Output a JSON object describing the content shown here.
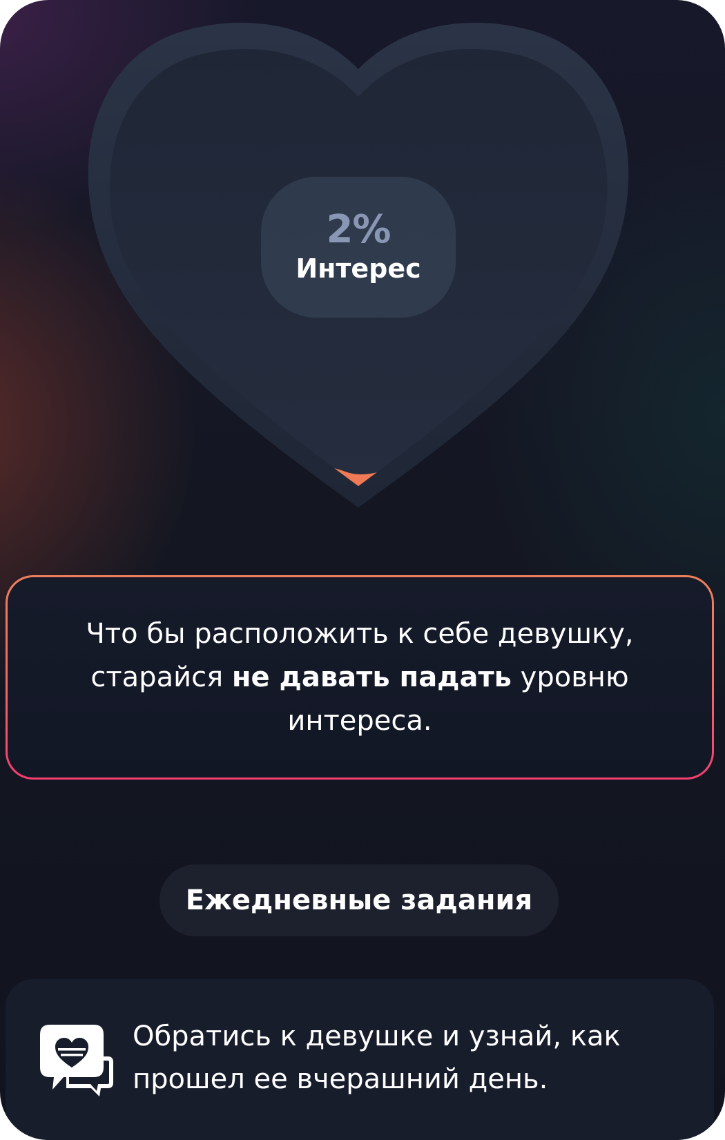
{
  "interest": {
    "value": "2%",
    "label": "Интерес",
    "level": 0.02
  },
  "tip": {
    "line1": "Что бы расположить к себе девушку,",
    "line2_before": "старайся ",
    "line2_bold": "не давать падать",
    "line2_after": " уровню",
    "line3": "интереса."
  },
  "daily_tasks": {
    "button_label": "Ежедневные задания"
  },
  "task": {
    "icon": "heart-chat-icon",
    "text": "Обратись к девушке и узнай, как прошел ее вчерашний день."
  },
  "colors": {
    "accent_gradient_start": "#f0805c",
    "accent_gradient_end": "#f33d70",
    "heart_fill": "#f07a55",
    "background": "#141722"
  }
}
